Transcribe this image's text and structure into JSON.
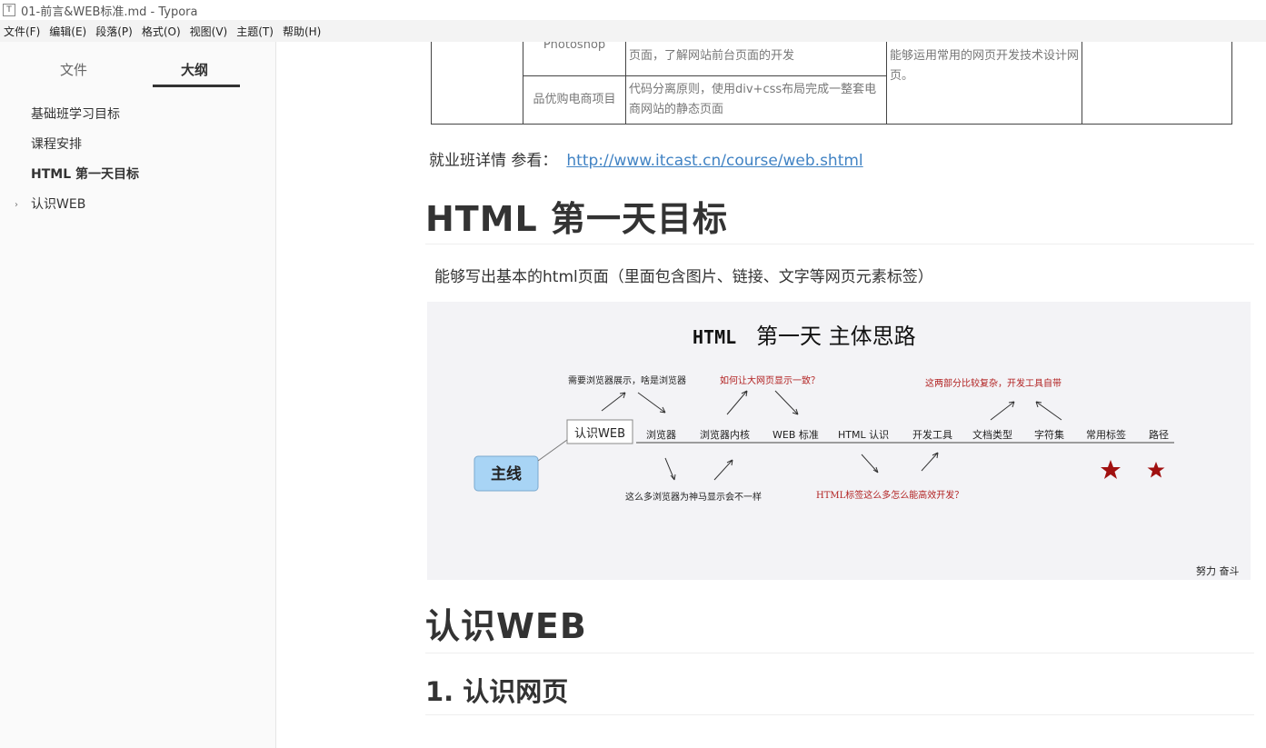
{
  "window": {
    "title": "01-前言&WEB标准.md - Typora",
    "icon": "typora-icon"
  },
  "menu": [
    "文件(F)",
    "编辑(E)",
    "段落(P)",
    "格式(O)",
    "视图(V)",
    "主题(T)",
    "帮助(H)"
  ],
  "sidebar": {
    "tabs": {
      "files": "文件",
      "outline": "大纲"
    },
    "items": [
      {
        "label": "基础班学习目标"
      },
      {
        "label": "课程安排"
      },
      {
        "label": "HTML 第一天目标"
      },
      {
        "label": "认识WEB"
      }
    ],
    "footer": {
      "back": "<",
      "source": "</>"
    }
  },
  "table": {
    "r1c2": "Photoshop",
    "r1c3": "页面，了解网站前台页面的开发",
    "r1c4": "能够运用常用的网页开发技术设计网页。",
    "r2c2": "品优购电商项目",
    "r2c3": "代码分离原则，使用div+css布局完成一整套电商网站的静态页面"
  },
  "content": {
    "job_text": "就业班详情 参看：",
    "job_link": "http://www.itcast.cn/course/web.shtml",
    "h1_day": "HTML 第一天目标",
    "day_para": "能够写出基本的html页面（里面包含图片、链接、文字等网页元素标签）",
    "h1_web": "认识WEB",
    "h2_web": "1. 认识网页"
  },
  "mindmap": {
    "title_a": "HTML",
    "title_b": "第一天  主体思路",
    "main": "主线",
    "root": "认识WEB",
    "nodes": [
      "浏览器",
      "浏览器内核",
      "WEB 标准",
      "HTML 认识",
      "开发工具",
      "文档类型",
      "字符集",
      "常用标签",
      "路径"
    ],
    "notes": {
      "n1": "需要浏览器展示，啥是浏览器",
      "n2": "如何让大网页显示一致？",
      "n3": "这两部分比较复杂，开发工具自带",
      "n4": "这么多浏览器为神马显示会不一样",
      "n5": "HTML标签这么多怎么能高效开发？"
    },
    "signature": "努力 奋斗",
    "colors": {
      "red": "#b22222",
      "star": "#a01010",
      "main_box": "#a8d4f5"
    }
  }
}
